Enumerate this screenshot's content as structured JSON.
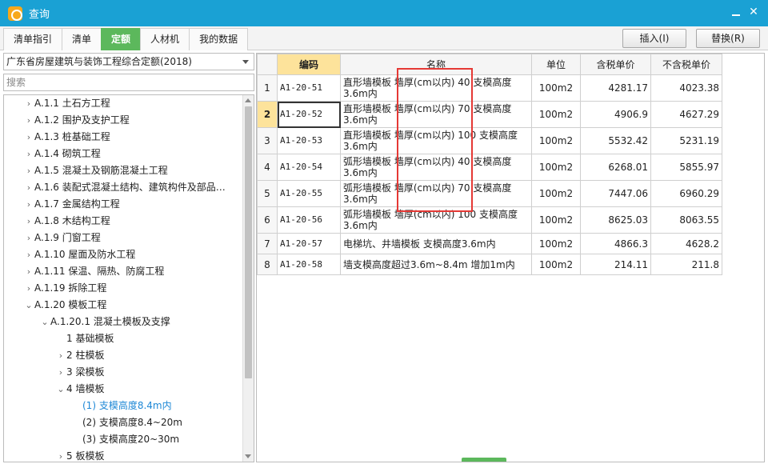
{
  "window": {
    "title": "查询",
    "icon": "app-logo-icon",
    "minimize": "minimize-icon",
    "close": "close-icon"
  },
  "tabs": [
    {
      "label": "清单指引"
    },
    {
      "label": "清单"
    },
    {
      "label": "定额",
      "active": true
    },
    {
      "label": "人材机"
    },
    {
      "label": "我的数据"
    }
  ],
  "actions": {
    "insert": "插入(I)",
    "replace": "替换(R)"
  },
  "left": {
    "dropdown_value": "广东省房屋建筑与装饰工程综合定额(2018)",
    "search_placeholder": "搜索",
    "tree": [
      {
        "chev": "›",
        "label": "A.1.1 土石方工程",
        "indent": 0
      },
      {
        "chev": "›",
        "label": "A.1.2 围护及支护工程",
        "indent": 0
      },
      {
        "chev": "›",
        "label": "A.1.3 桩基础工程",
        "indent": 0
      },
      {
        "chev": "›",
        "label": "A.1.4 砌筑工程",
        "indent": 0
      },
      {
        "chev": "›",
        "label": "A.1.5 混凝土及钢筋混凝土工程",
        "indent": 0
      },
      {
        "chev": "›",
        "label": "A.1.6 装配式混凝土结构、建筑构件及部品…",
        "indent": 0
      },
      {
        "chev": "›",
        "label": "A.1.7 金属结构工程",
        "indent": 0
      },
      {
        "chev": "›",
        "label": "A.1.8 木结构工程",
        "indent": 0
      },
      {
        "chev": "›",
        "label": "A.1.9 门窗工程",
        "indent": 0
      },
      {
        "chev": "›",
        "label": "A.1.10 屋面及防水工程",
        "indent": 0
      },
      {
        "chev": "›",
        "label": "A.1.11 保温、隔热、防腐工程",
        "indent": 0
      },
      {
        "chev": "›",
        "label": "A.1.19 拆除工程",
        "indent": 0
      },
      {
        "chev": "⌄",
        "label": "A.1.20 模板工程",
        "indent": 0
      },
      {
        "chev": "⌄",
        "label": "A.1.20.1 混凝土模板及支撑",
        "indent": 1
      },
      {
        "chev": "",
        "label": "1 基础模板",
        "indent": 2
      },
      {
        "chev": "›",
        "label": "2 柱模板",
        "indent": 2
      },
      {
        "chev": "›",
        "label": "3 梁模板",
        "indent": 2
      },
      {
        "chev": "⌄",
        "label": "4 墙模板",
        "indent": 2
      },
      {
        "chev": "",
        "label": "(1) 支模高度8.4m内",
        "indent": 3,
        "selected": true
      },
      {
        "chev": "",
        "label": "(2) 支模高度8.4~20m",
        "indent": 3
      },
      {
        "chev": "",
        "label": "(3) 支模高度20~30m",
        "indent": 3
      },
      {
        "chev": "›",
        "label": "5 板模板",
        "indent": 2
      }
    ]
  },
  "grid": {
    "headers": {
      "idx": "",
      "code": "编码",
      "name": "名称",
      "unit": "单位",
      "price_tax": "含税单价",
      "price_notax": "不含税单价"
    },
    "rows": [
      {
        "idx": "1",
        "code": "A1-20-51",
        "name": "直形墙模板 墙厚(cm以内) 40 支模高度3.6m内",
        "unit": "100m2",
        "price_tax": "4281.17",
        "price_notax": "4023.38"
      },
      {
        "idx": "2",
        "code": "A1-20-52",
        "name": "直形墙模板 墙厚(cm以内) 70 支模高度3.6m内",
        "unit": "100m2",
        "price_tax": "4906.9",
        "price_notax": "4627.29",
        "current": true
      },
      {
        "idx": "3",
        "code": "A1-20-53",
        "name": "直形墙模板 墙厚(cm以内) 100 支模高度3.6m内",
        "unit": "100m2",
        "price_tax": "5532.42",
        "price_notax": "5231.19"
      },
      {
        "idx": "4",
        "code": "A1-20-54",
        "name": "弧形墙模板 墙厚(cm以内) 40 支模高度3.6m内",
        "unit": "100m2",
        "price_tax": "6268.01",
        "price_notax": "5855.97"
      },
      {
        "idx": "5",
        "code": "A1-20-55",
        "name": "弧形墙模板 墙厚(cm以内) 70 支模高度3.6m内",
        "unit": "100m2",
        "price_tax": "7447.06",
        "price_notax": "6960.29"
      },
      {
        "idx": "6",
        "code": "A1-20-56",
        "name": "弧形墙模板 墙厚(cm以内) 100 支模高度3.6m内",
        "unit": "100m2",
        "price_tax": "8625.03",
        "price_notax": "8063.55"
      },
      {
        "idx": "7",
        "code": "A1-20-57",
        "name": "电梯坑、井墙模板 支模高度3.6m内",
        "unit": "100m2",
        "price_tax": "4866.3",
        "price_notax": "4628.2"
      },
      {
        "idx": "8",
        "code": "A1-20-58",
        "name": "墙支模高度超过3.6m~8.4m 增加1m内",
        "unit": "100m2",
        "price_tax": "214.11",
        "price_notax": "211.8"
      }
    ]
  },
  "colors": {
    "titlebar": "#1aa1d4",
    "active_tab": "#5cb85c",
    "header_highlight": "#fde39b",
    "annotation": "#e53935",
    "selected_text": "#1e88d6"
  }
}
